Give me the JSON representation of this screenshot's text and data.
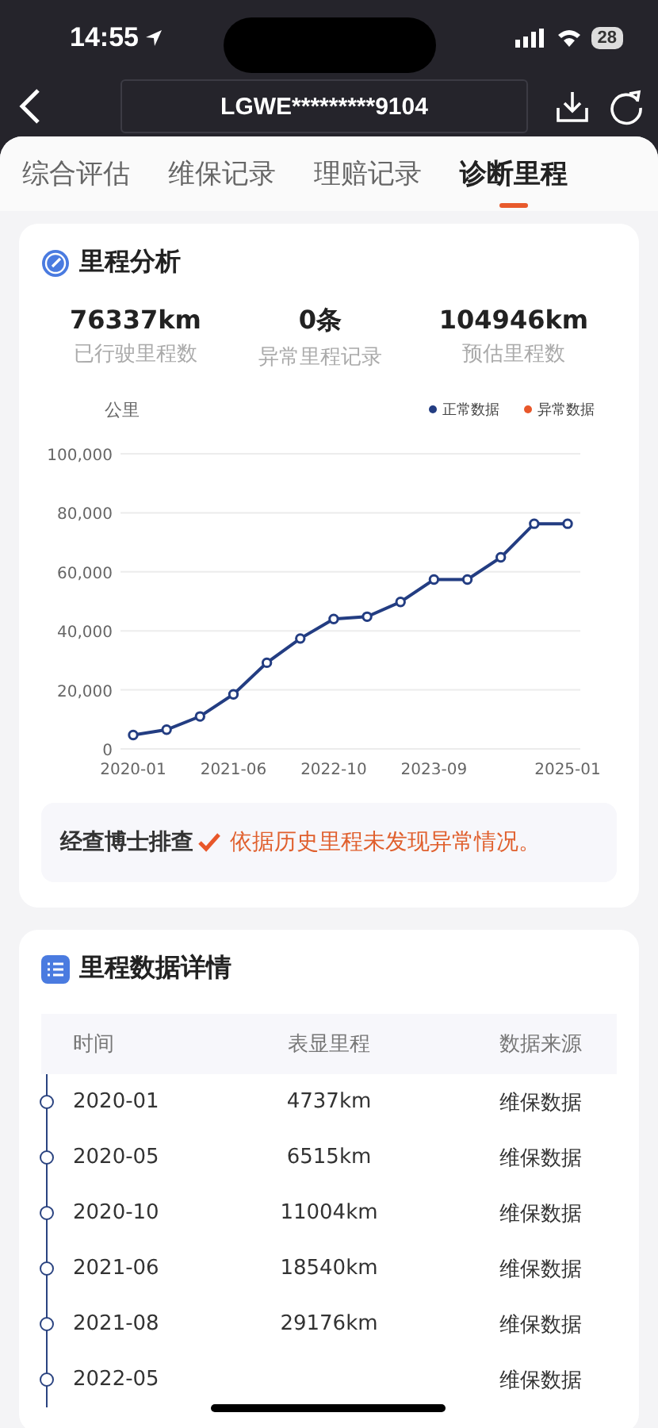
{
  "status_bar": {
    "time": "14:55",
    "battery": "28"
  },
  "header": {
    "vin": "LGWE*********9104"
  },
  "tabs": [
    {
      "label": "综合评估",
      "selected": false
    },
    {
      "label": "维保记录",
      "selected": false
    },
    {
      "label": "理赔记录",
      "selected": false
    },
    {
      "label": "诊断里程",
      "selected": true
    }
  ],
  "analysis": {
    "title": "里程分析",
    "stats": [
      {
        "value": "76337km",
        "label": "已行驶里程数"
      },
      {
        "value": "0条",
        "label": "异常里程记录"
      },
      {
        "value": "104946km",
        "label": "预估里程数"
      }
    ],
    "chart_data": {
      "type": "line",
      "grid": true,
      "ylabel": "公里",
      "categories": [
        "2020-01",
        null,
        null,
        "2021-06",
        null,
        null,
        "2022-10",
        null,
        null,
        "2023-09",
        null,
        null,
        null,
        "2025-01"
      ],
      "ylim": [
        0,
        100000
      ],
      "yticks": [
        {
          "value": 0,
          "label": "0"
        },
        {
          "value": 20000,
          "label": "20,000"
        },
        {
          "value": 40000,
          "label": "40,000"
        },
        {
          "value": 60000,
          "label": "60,000"
        },
        {
          "value": 80000,
          "label": "80,000"
        },
        {
          "value": 100000,
          "label": "100,000"
        }
      ],
      "series": [
        {
          "name": "正常数据",
          "color": "#233d82",
          "marker": "circle",
          "values": [
            4700,
            6500,
            11000,
            18500,
            29200,
            37400,
            44000,
            44800,
            49800,
            57400,
            57400,
            64900,
            76300,
            76300
          ]
        },
        {
          "name": "异常数据",
          "color": "#e8572a",
          "values": [
            null,
            null,
            null,
            null,
            null,
            null,
            null,
            null,
            null,
            null,
            null,
            null,
            null,
            null
          ]
        }
      ]
    },
    "notice": {
      "lead": "经查博士排查",
      "text": "依据历史里程未发现异常情况。"
    }
  },
  "details": {
    "title": "里程数据详情",
    "columns": [
      "时间",
      "表显里程",
      "数据来源"
    ],
    "rows": [
      {
        "date": "2020-01",
        "mileage": "4737km",
        "source": "维保数据"
      },
      {
        "date": "2020-05",
        "mileage": "6515km",
        "source": "维保数据"
      },
      {
        "date": "2020-10",
        "mileage": "11004km",
        "source": "维保数据"
      },
      {
        "date": "2021-06",
        "mileage": "18540km",
        "source": "维保数据"
      },
      {
        "date": "2021-08",
        "mileage": "29176km",
        "source": "维保数据"
      },
      {
        "date": "2022-05",
        "source": "维保数据"
      }
    ]
  }
}
